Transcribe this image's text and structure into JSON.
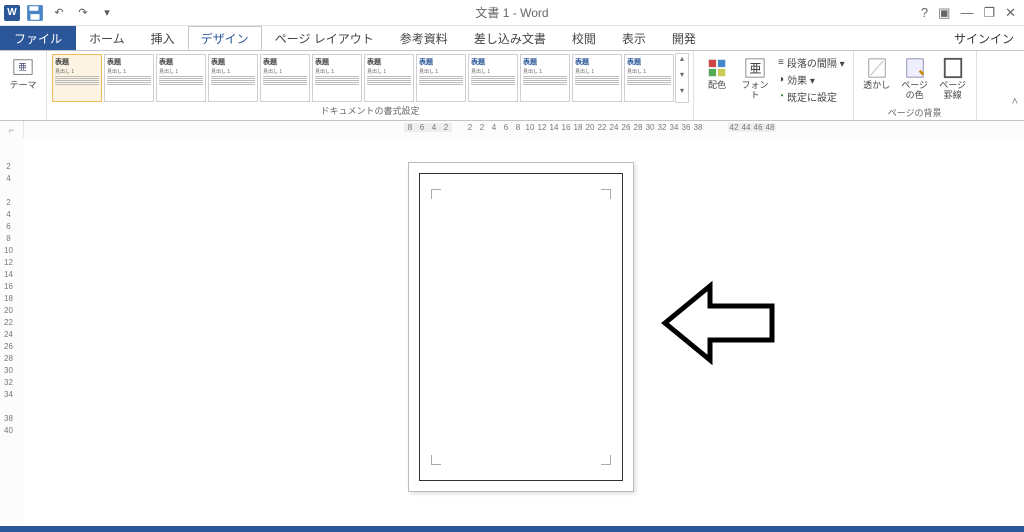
{
  "titlebar": {
    "word_badge": "W",
    "doc_title": "文書 1 - Word",
    "help_icon": "?",
    "ribbon_opts_icon": "▣",
    "minimize_icon": "—",
    "restore_icon": "❐",
    "close_icon": "✕"
  },
  "qat": {
    "save_icon": "💾",
    "undo_icon": "↶",
    "redo_icon": "↷",
    "customize_icon": "▾"
  },
  "tabs": {
    "file": "ファイル",
    "home": "ホーム",
    "insert": "挿入",
    "design": "デザイン",
    "layout": "ページ レイアウト",
    "references": "参考資料",
    "mailings": "差し込み文書",
    "review": "校閲",
    "view": "表示",
    "developer": "開発",
    "signin": "サインイン"
  },
  "ribbon": {
    "themes_label": "テーマ",
    "gallery": {
      "items": [
        {
          "title": "表題",
          "sub": "見出し 1"
        },
        {
          "title": "表題",
          "sub": "見出し 1"
        },
        {
          "title": "表題",
          "sub": "見出し 1"
        },
        {
          "title": "表題",
          "sub": "見出し 1"
        },
        {
          "title": "表題",
          "sub": "見出し 1"
        },
        {
          "title": "表題",
          "sub": "見出し 1"
        },
        {
          "title": "表題",
          "sub": "見出し 1"
        },
        {
          "title": "表題",
          "sub": "見出し 1"
        },
        {
          "title": "表題",
          "sub": "見出し 1"
        },
        {
          "title": "表題",
          "sub": "見出し 1"
        },
        {
          "title": "表題",
          "sub": "見出し 1"
        },
        {
          "title": "表題",
          "sub": "見出し 1"
        }
      ],
      "group_label": "ドキュメントの書式設定"
    },
    "colors_label": "配色",
    "fonts_label": "フォント",
    "para_spacing": "段落の間隔 ▾",
    "effects": "効果 ▾",
    "set_default": "既定に設定",
    "watermark": "透かし",
    "page_color": "ページの色",
    "page_borders": "ページ罫線",
    "page_bg_label": "ページの背景"
  },
  "ruler": {
    "h_ticks_left": [
      "8",
      "6",
      "4",
      "2"
    ],
    "h_center": "2",
    "h_ticks_right": [
      "2",
      "4",
      "6",
      "8",
      "10",
      "12",
      "14",
      "16",
      "18",
      "20",
      "22",
      "24",
      "26",
      "28",
      "30",
      "32",
      "34",
      "36",
      "38"
    ],
    "h_shade_right": [
      "42",
      "44",
      "46",
      "48"
    ],
    "v_ticks": [
      "2",
      "4",
      "",
      "2",
      "4",
      "6",
      "8",
      "10",
      "12",
      "14",
      "16",
      "18",
      "20",
      "22",
      "24",
      "26",
      "28",
      "30",
      "32",
      "34",
      "",
      "38",
      "40"
    ]
  },
  "annotation": {
    "arrow_dir": "left"
  }
}
